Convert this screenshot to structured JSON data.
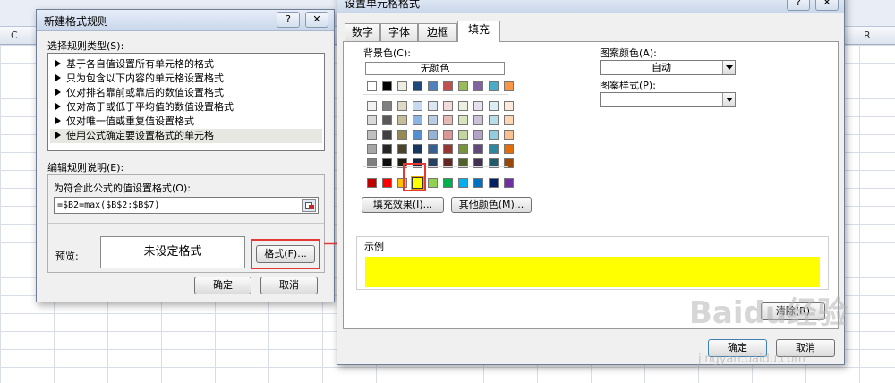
{
  "sheet": {
    "col_c": "C",
    "col_r": "R"
  },
  "cf_dialog": {
    "title": "新建格式规则",
    "help_btn": "?",
    "close_btn": "✕",
    "select_rule_type_label": "选择规则类型(S):",
    "rules": [
      "基于各自值设置所有单元格的格式",
      "只为包含以下内容的单元格设置格式",
      "仅对排名靠前或靠后的数值设置格式",
      "仅对高于或低于平均值的数值设置格式",
      "仅对唯一值或重复值设置格式",
      "使用公式确定要设置格式的单元格"
    ],
    "edit_desc_label": "编辑规则说明(E):",
    "formula_label": "为符合此公式的值设置格式(O):",
    "formula_value": "=$B2=max($B$2:$B$7)",
    "preview_label": "预览:",
    "preview_text": "未设定格式",
    "format_btn": "格式(F)...",
    "ok_btn": "确定",
    "cancel_btn": "取消",
    "selected_rule_index": 5
  },
  "fmt_dialog": {
    "title": "设置单元格格式",
    "help_btn": "?",
    "close_btn": "✕",
    "tabs": [
      "数字",
      "字体",
      "边框",
      "填充"
    ],
    "active_tab": "填充",
    "bg_color_label": "背景色(C):",
    "no_color_btn": "无颜色",
    "pattern_color_label": "图案颜色(A):",
    "pattern_color_value": "自动",
    "pattern_style_label": "图案样式(P):",
    "fill_effects_btn": "填充效果(I)...",
    "more_colors_btn": "其他颜色(M)...",
    "sample_label": "示例",
    "sample_color": "#ffff00",
    "clear_btn": "清除(R)",
    "ok_btn": "确定",
    "cancel_btn": "取消",
    "selected_color": "#ffff00",
    "theme_row": [
      "#ffffff",
      "#000000",
      "#eeece1",
      "#1f497d",
      "#4f81bd",
      "#c0504d",
      "#9bbb59",
      "#8064a2",
      "#4bacc6",
      "#f79646"
    ],
    "tint_rows": [
      [
        "#f2f2f2",
        "#808080",
        "#ddd9c4",
        "#c6d9f1",
        "#dce6f2",
        "#f2dcdb",
        "#ebf1de",
        "#e6e0ec",
        "#dbeef4",
        "#fdeada"
      ],
      [
        "#d9d9d9",
        "#595959",
        "#c4bd97",
        "#8eb4e3",
        "#b9cde5",
        "#e6b9b8",
        "#d7e4bd",
        "#ccc1da",
        "#b7dee8",
        "#fcd5b5"
      ],
      [
        "#bfbfbf",
        "#404040",
        "#948a54",
        "#558ed5",
        "#95b3d7",
        "#d99694",
        "#c3d69b",
        "#b3a2c7",
        "#93cddd",
        "#fac090"
      ],
      [
        "#a6a6a6",
        "#262626",
        "#4a452a",
        "#17375e",
        "#376092",
        "#953735",
        "#77933c",
        "#604a7b",
        "#31859c",
        "#e46c0a"
      ],
      [
        "#7f7f7f",
        "#0d0d0d",
        "#1e1c11",
        "#10243f",
        "#254061",
        "#632523",
        "#4f6228",
        "#403152",
        "#215968",
        "#984807"
      ]
    ],
    "standard_row": [
      "#c00000",
      "#ff0000",
      "#ffc000",
      "#ffff00",
      "#92d050",
      "#00b050",
      "#00b0f0",
      "#0070c0",
      "#002060",
      "#7030a0"
    ]
  },
  "watermark": {
    "brand": "Baidu经验",
    "url": "jingyan.baidu.com"
  },
  "annotation": {
    "color": "#e53935"
  }
}
